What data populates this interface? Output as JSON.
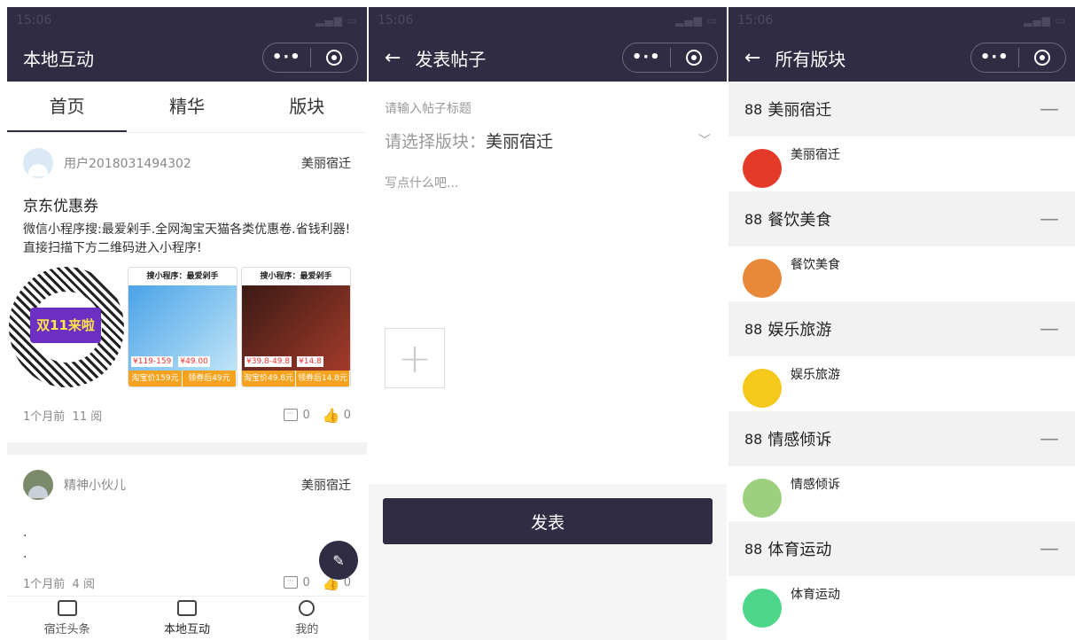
{
  "status": {
    "time": "15:06"
  },
  "screen1": {
    "title": "本地互动",
    "tabs": [
      "首页",
      "精华",
      "版块"
    ],
    "posts": [
      {
        "user": "用户2018031494302",
        "board": "美丽宿迁",
        "title": "京东优惠券",
        "body1": "微信小程序搜:最爱剁手.全网淘宝天猫各类优惠卷.省钱利器!",
        "body2": "直接扫描下方二维码进入小程序!",
        "time": "1个月前",
        "reads": "11 阅",
        "comments": "0",
        "likes": "0",
        "img_badge": "双11来啦",
        "img_top1": "搜小程序：最爱剁手",
        "img_top2": "搜小程序：最爱剁手",
        "price1": "¥119-159",
        "price2": "¥49.00",
        "price3": "¥39.8-49.8",
        "price4": "¥14.8",
        "bar1": "淘宝价159元",
        "bar2": "领券后49元",
        "bar3": "淘宝价49.8元",
        "bar4": "领券后14.8元"
      },
      {
        "user": "精神小伙儿",
        "board": "美丽宿迁",
        "time": "1个月前",
        "reads": "4 阅",
        "comments": "0",
        "likes": "0",
        "dot1": ".",
        "dot2": "."
      }
    ],
    "tabbar": [
      "宿迁头条",
      "本地互动",
      "我的"
    ]
  },
  "screen2": {
    "title": "发表帖子",
    "title_placeholder": "请输入帖子标题",
    "board_label": "请选择版块：",
    "board_value": "美丽宿迁",
    "content_placeholder": "写点什么吧...",
    "submit": "发表"
  },
  "screen3": {
    "title": "所有版块",
    "sections": [
      {
        "name": "美丽宿迁",
        "item": "美丽宿迁",
        "color": "#e53a2a"
      },
      {
        "name": "餐饮美食",
        "item": "餐饮美食",
        "color": "#e8893a"
      },
      {
        "name": "娱乐旅游",
        "item": "娱乐旅游",
        "color": "#f5c81c"
      },
      {
        "name": "情感倾诉",
        "item": "情感倾诉",
        "color": "#9ccf7e"
      },
      {
        "name": "体育运动",
        "item": "体育运动",
        "color": "#4dd68a"
      }
    ]
  }
}
